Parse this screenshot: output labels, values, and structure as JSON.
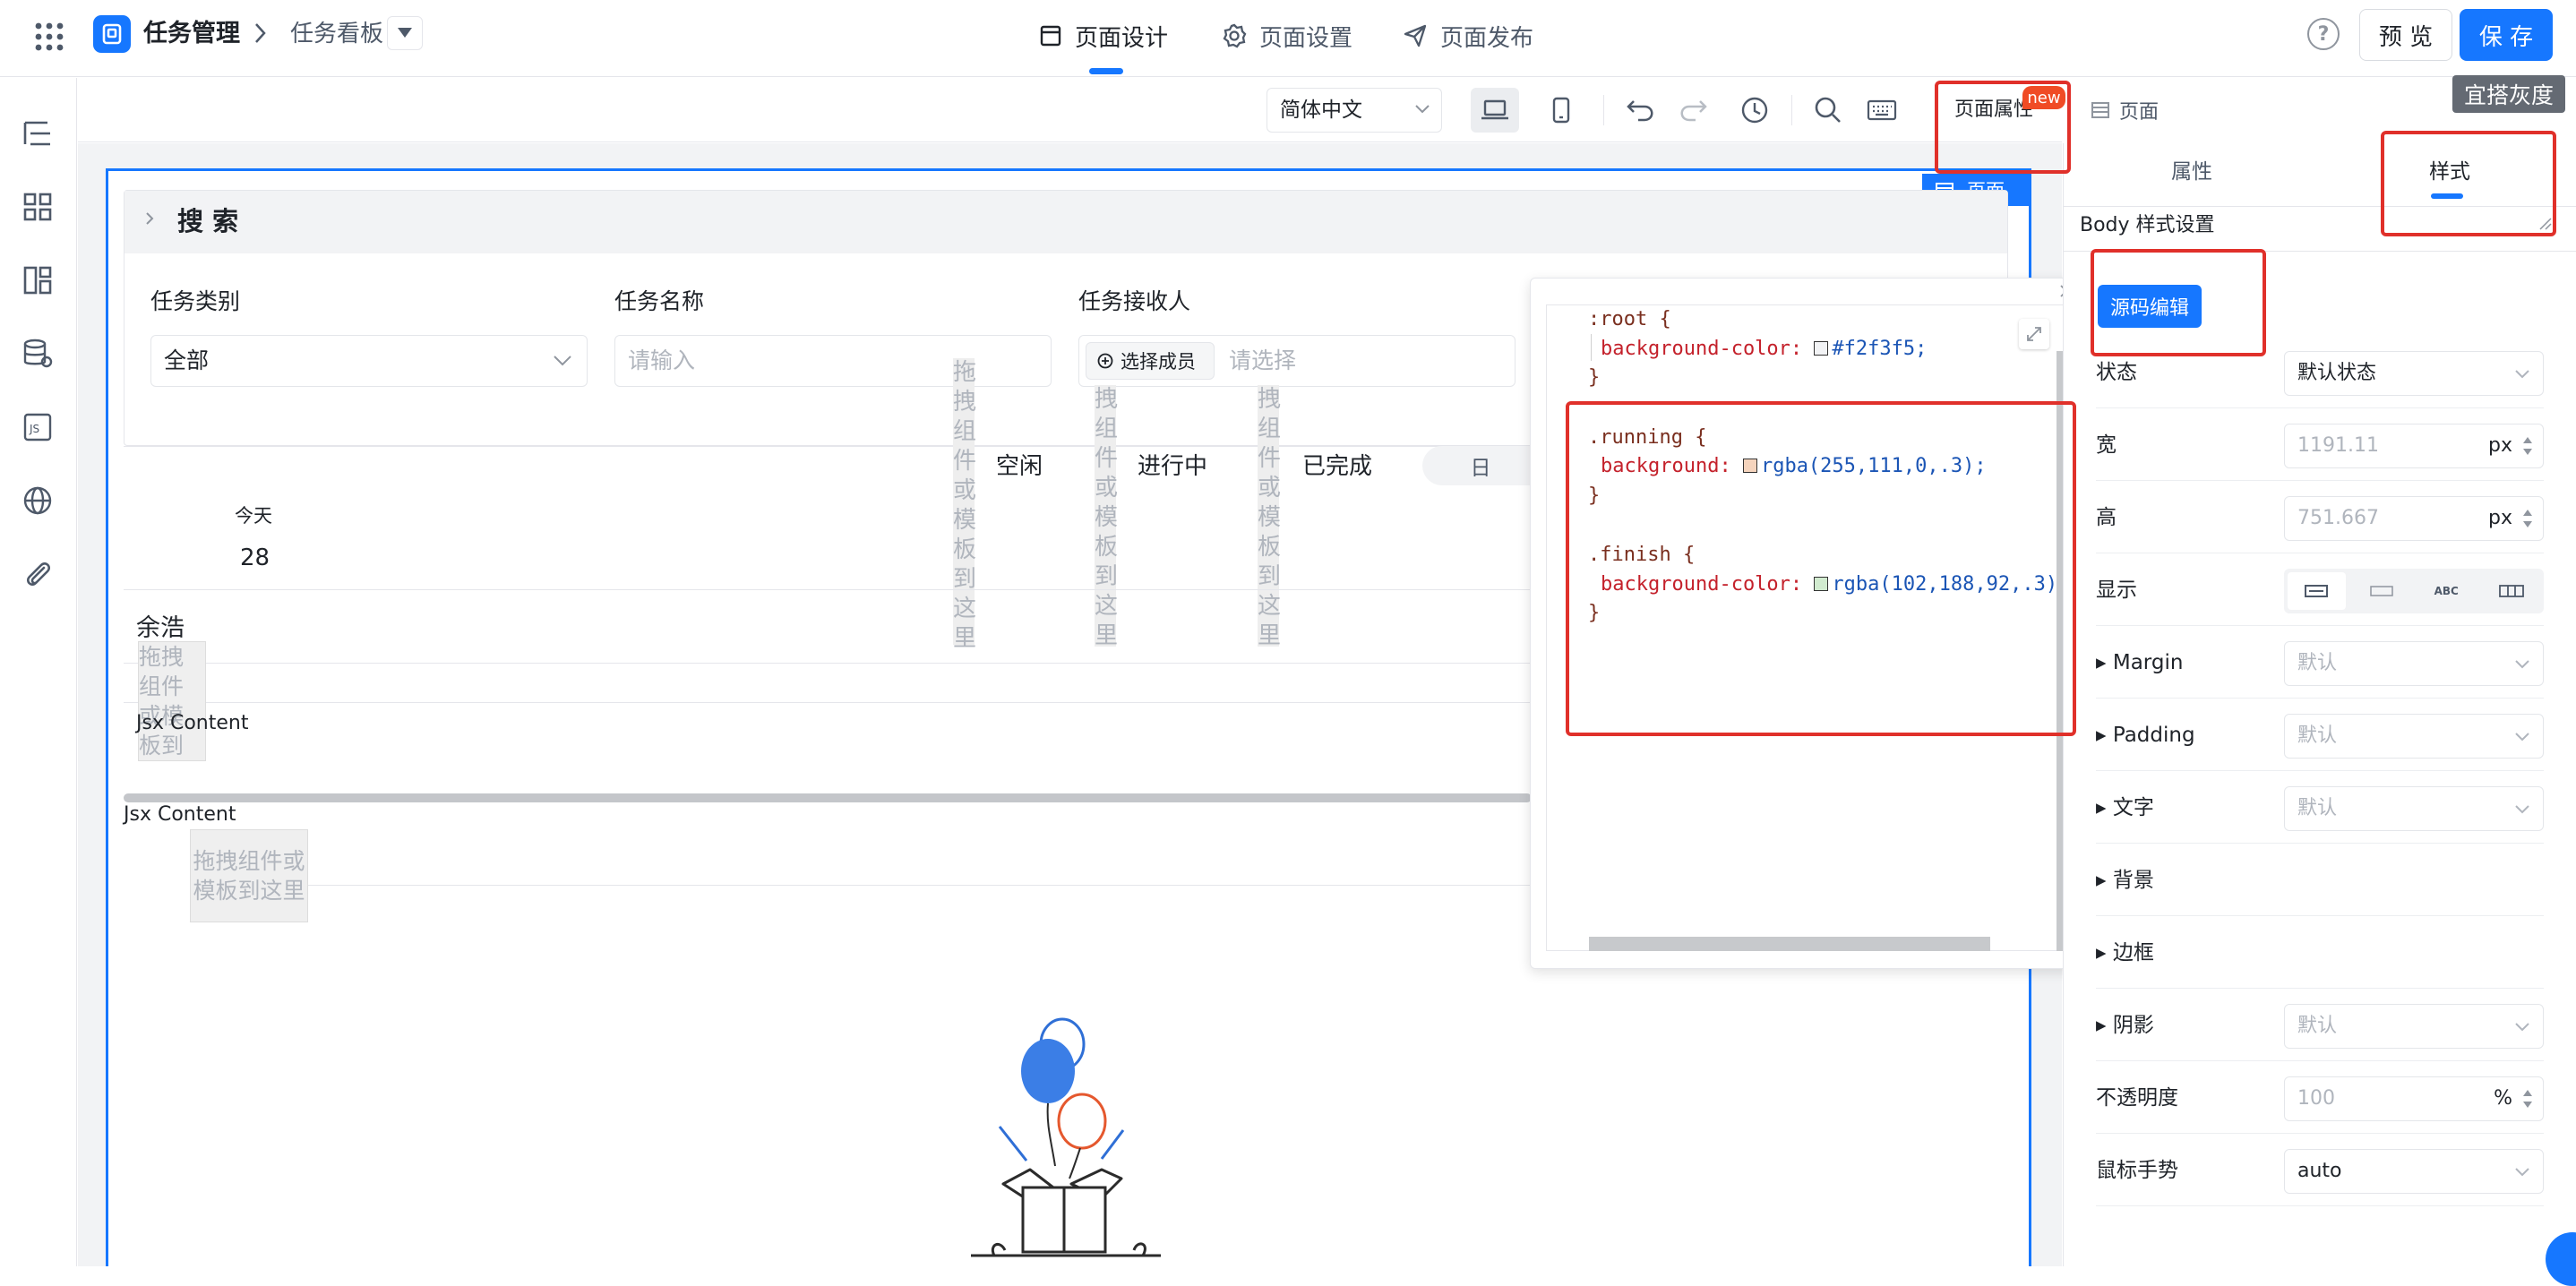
{
  "topbar": {
    "app_name": "任务管理",
    "breadcrumb_page": "任务看板",
    "tabs": [
      {
        "label": "页面设计",
        "active": true
      },
      {
        "label": "页面设置",
        "active": false
      },
      {
        "label": "页面发布",
        "active": false
      }
    ],
    "preview_label": "预 览",
    "save_label": "保 存",
    "tooltip": "宜搭灰度"
  },
  "toolbar": {
    "language": "简体中文",
    "page_props_label": "页面属性",
    "new_badge": "new",
    "page_label": "页面"
  },
  "canvas": {
    "page_tag": "页面",
    "search_title": "搜 索",
    "filters": [
      {
        "label": "任务类别",
        "value": "全部"
      },
      {
        "label": "任务名称",
        "placeholder": "请输入"
      },
      {
        "label": "任务接收人",
        "button": "选择成员",
        "placeholder": "请选择"
      }
    ],
    "drop_hint_vertical": "拖拽组件或模板到这里",
    "drop_hint_v2": "拽组件或模板到这里",
    "drop_hint_v3": "拽组件或模板到这里",
    "status_labels": [
      "空闲",
      "进行中",
      "已完成"
    ],
    "day_toggle": "日",
    "today_label": "今天",
    "today_date": "28",
    "person": "余浩",
    "drop_hint_small": "拖拽组件或模板到这里",
    "jsx_content_1": "Jsx Content",
    "jsx_content_2": "Jsx Content",
    "drop_hint_box": "拖拽组件或模板到这里"
  },
  "code_editor": {
    "lines": [
      {
        "t": "sel",
        "text": ":root {"
      },
      {
        "t": "prop",
        "prop": "background-color:",
        "swatch": "#f2f3f5",
        "val": "#f2f3f5;"
      },
      {
        "t": "close",
        "text": "}"
      },
      {
        "t": "blank"
      },
      {
        "t": "sel",
        "text": ".running {"
      },
      {
        "t": "prop",
        "prop": "background:",
        "swatch": "#f5d4bd",
        "val": "rgba(255,111,0,.3);"
      },
      {
        "t": "close",
        "text": "}"
      },
      {
        "t": "blank"
      },
      {
        "t": "sel",
        "text": ".finish {"
      },
      {
        "t": "prop",
        "prop": "background-color:",
        "swatch": "#d1ebcf",
        "val": "rgba(102,188,92,.3)"
      },
      {
        "t": "close",
        "text": "}"
      }
    ]
  },
  "panel": {
    "tab_props": "属性",
    "tab_style": "样式",
    "section_title": "Body 样式设置",
    "source_edit_button": "源码编辑",
    "rows": [
      {
        "label": "状态",
        "value": "默认状态",
        "type": "select"
      },
      {
        "label": "宽",
        "value": "1191.11",
        "unit": "px",
        "type": "number"
      },
      {
        "label": "高",
        "value": "751.667",
        "unit": "px",
        "type": "number"
      },
      {
        "label": "显示",
        "type": "display",
        "options": [
          "block",
          "inline",
          "ABC",
          "flex"
        ]
      },
      {
        "label": "Margin",
        "value": "默认",
        "type": "select",
        "collapsible": true
      },
      {
        "label": "Padding",
        "value": "默认",
        "type": "select",
        "collapsible": true
      },
      {
        "label": "文字",
        "value": "默认",
        "type": "select",
        "collapsible": true
      },
      {
        "label": "背景",
        "type": "none",
        "collapsible": true
      },
      {
        "label": "边框",
        "type": "none",
        "collapsible": true
      },
      {
        "label": "阴影",
        "value": "默认",
        "type": "select",
        "collapsible": true
      },
      {
        "label": "不透明度",
        "value": "100",
        "unit": "%",
        "type": "number"
      },
      {
        "label": "鼠标手势",
        "value": "auto",
        "type": "select"
      }
    ]
  },
  "colors": {
    "primary": "#1677ff",
    "highlight_red": "#e0302a",
    "canvas_bg": "#f2f3f5"
  }
}
